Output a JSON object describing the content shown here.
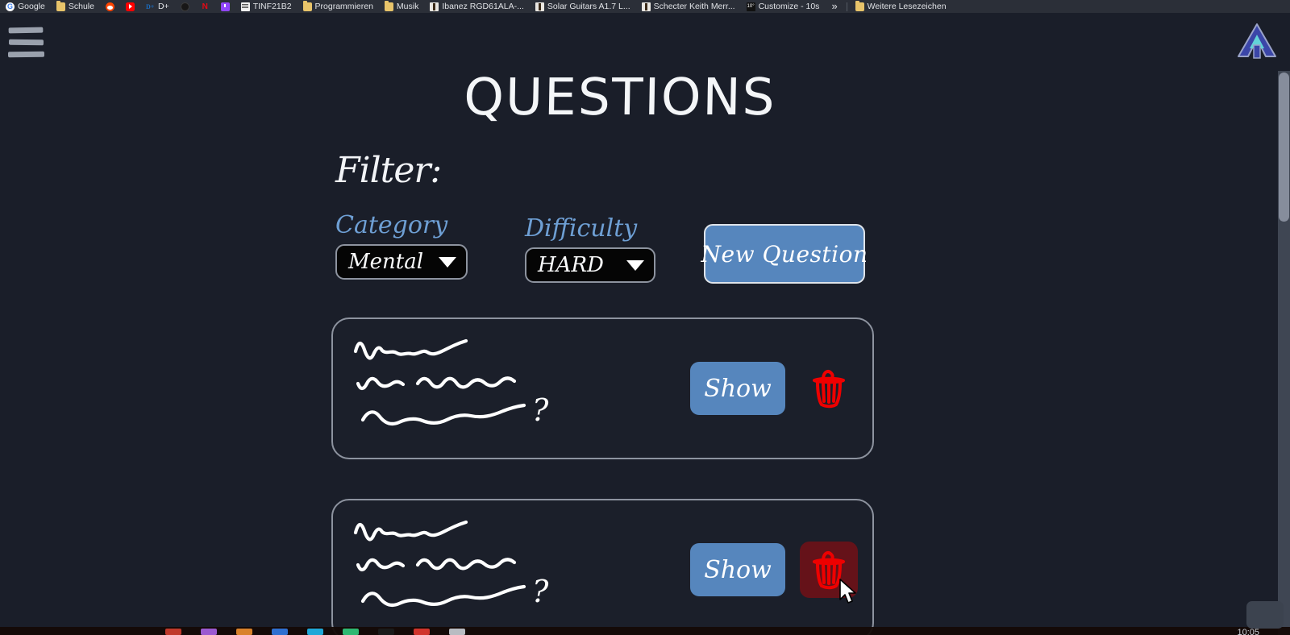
{
  "browser": {
    "bookmarks": [
      {
        "label": "Google",
        "icon": "google-icon",
        "icon_class": "ico-google"
      },
      {
        "label": "Schule",
        "icon": "folder-icon",
        "icon_class": "ico-folder"
      },
      {
        "label": "",
        "icon": "reddit-icon",
        "icon_class": "ico-reddit"
      },
      {
        "label": "",
        "icon": "youtube-icon",
        "icon_class": "ico-youtube"
      },
      {
        "label": "D+",
        "icon": "disney-plus-icon",
        "icon_class": "ico-disney"
      },
      {
        "label": "",
        "icon": "github-icon",
        "icon_class": "ico-github"
      },
      {
        "label": "",
        "icon": "netflix-icon",
        "icon_class": "ico-netflix"
      },
      {
        "label": "",
        "icon": "twitch-icon",
        "icon_class": "ico-twitch"
      },
      {
        "label": "TINF21B2",
        "icon": "document-icon",
        "icon_class": "ico-doc"
      },
      {
        "label": "Programmieren",
        "icon": "folder-icon",
        "icon_class": "ico-folder"
      },
      {
        "label": "Musik",
        "icon": "folder-icon",
        "icon_class": "ico-folder"
      },
      {
        "label": "Ibanez RGD61ALA-...",
        "icon": "guitar-icon",
        "icon_class": "ico-guitar"
      },
      {
        "label": "Solar Guitars A1.7 L...",
        "icon": "guitar-icon",
        "icon_class": "ico-guitar"
      },
      {
        "label": "Schecter Keith Merr...",
        "icon": "guitar-icon",
        "icon_class": "ico-guitar"
      },
      {
        "label": "Customize - 10s",
        "icon": "tos-icon",
        "icon_class": "ico-tos"
      }
    ],
    "overflow_label": "»",
    "other_bookmarks": {
      "label": "Weitere Lesezeichen",
      "icon": "folder-icon",
      "icon_class": "ico-folder"
    }
  },
  "app": {
    "title": "QUESTIONS",
    "menu_icon": "hamburger-menu-icon",
    "logo_icon": "app-logo-a-icon"
  },
  "filter": {
    "heading": "Filter:",
    "category": {
      "label": "Category",
      "selected": "Mental",
      "options": [
        "Mental"
      ]
    },
    "difficulty": {
      "label": "Difficulty",
      "selected": "HARD",
      "options": [
        "HARD"
      ]
    }
  },
  "actions": {
    "new_question": "New Question"
  },
  "questions": [
    {
      "id": 1,
      "text_hidden": true,
      "show_label": "Show",
      "delete_icon": "trash-icon",
      "delete_hovered": false
    },
    {
      "id": 2,
      "text_hidden": true,
      "show_label": "Show",
      "delete_icon": "trash-icon",
      "delete_hovered": true
    }
  ],
  "colors": {
    "page_background": "#1a1e29",
    "card_background": "#1b1f2a",
    "card_border": "#8d939f",
    "accent_blue": "#5686bd",
    "label_blue": "#6e9fd4",
    "trash_red": "#e60000",
    "trash_hover_background": "#651219",
    "text_white": "#f4f6f8",
    "scrollbar_thumb": "#868d9c",
    "scrollbar_track": "#3f4653"
  },
  "system": {
    "clock": "10:05"
  }
}
